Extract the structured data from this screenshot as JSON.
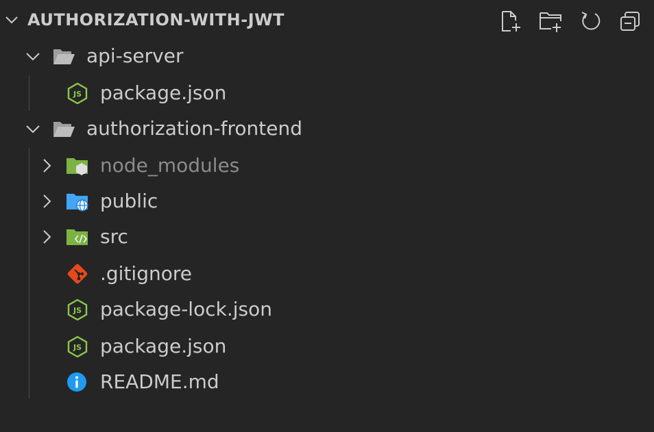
{
  "explorer": {
    "title": "AUTHORIZATION-WITH-JWT",
    "actions": [
      {
        "name": "new-file-icon",
        "label": "New File"
      },
      {
        "name": "new-folder-icon",
        "label": "New Folder"
      },
      {
        "name": "refresh-icon",
        "label": "Refresh Explorer"
      },
      {
        "name": "collapse-all-icon",
        "label": "Collapse Folders in Explorer"
      }
    ],
    "tree": {
      "api_server": {
        "label": "api-server",
        "expanded": true,
        "children": {
          "package_json": {
            "label": "package.json",
            "icon": "nodejs-icon"
          }
        }
      },
      "authorization_frontend": {
        "label": "authorization-frontend",
        "expanded": true,
        "children": {
          "node_modules": {
            "label": "node_modules",
            "icon": "node-modules-folder-icon",
            "expanded": false
          },
          "public": {
            "label": "public",
            "icon": "public-folder-icon",
            "expanded": false
          },
          "src": {
            "label": "src",
            "icon": "src-folder-icon",
            "expanded": false
          },
          "gitignore": {
            "label": ".gitignore",
            "icon": "git-icon"
          },
          "package_lock": {
            "label": "package-lock.json",
            "icon": "nodejs-icon"
          },
          "package_json": {
            "label": "package.json",
            "icon": "nodejs-icon"
          },
          "readme": {
            "label": "README.md",
            "icon": "info-icon"
          }
        }
      }
    },
    "colors": {
      "background": "#252526",
      "text": "#cccccc",
      "dimmed_text": "#8c8c8c",
      "node_green": "#8cc84b",
      "folder_green": "#7cb342",
      "folder_blue": "#42a5f5",
      "git_orange": "#e64a19",
      "info_blue": "#1e9bf0"
    }
  }
}
